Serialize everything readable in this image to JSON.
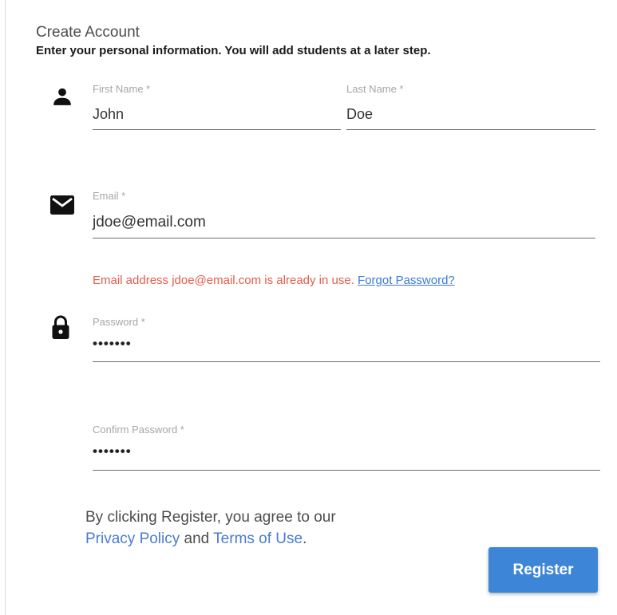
{
  "header": {
    "title": "Create Account",
    "subtitle": "Enter your personal information.  You will add students at a later step."
  },
  "fields": {
    "first_name": {
      "label": "First Name *",
      "value": "John"
    },
    "last_name": {
      "label": "Last Name *",
      "value": "Doe"
    },
    "email": {
      "label": "Email *",
      "value": "jdoe@email.com"
    },
    "password": {
      "label": "Password *",
      "value": "•••••••"
    },
    "confirm_password": {
      "label": "Confirm Password *",
      "value": "•••••••"
    }
  },
  "error": {
    "message": "Email address jdoe@email.com is already in use.",
    "link": "Forgot Password?"
  },
  "agreement": {
    "prefix": "By clicking Register, you agree to our",
    "privacy_link": "Privacy Policy",
    "and": "and",
    "terms_link": "Terms of Use",
    "suffix": "."
  },
  "register_label": "Register",
  "icons": {
    "person": "person-icon",
    "email": "envelope-icon",
    "password": "lock-icon"
  },
  "colors": {
    "accent": "#3d85d6",
    "error": "#e25c4b",
    "link": "#3a7bd5"
  }
}
